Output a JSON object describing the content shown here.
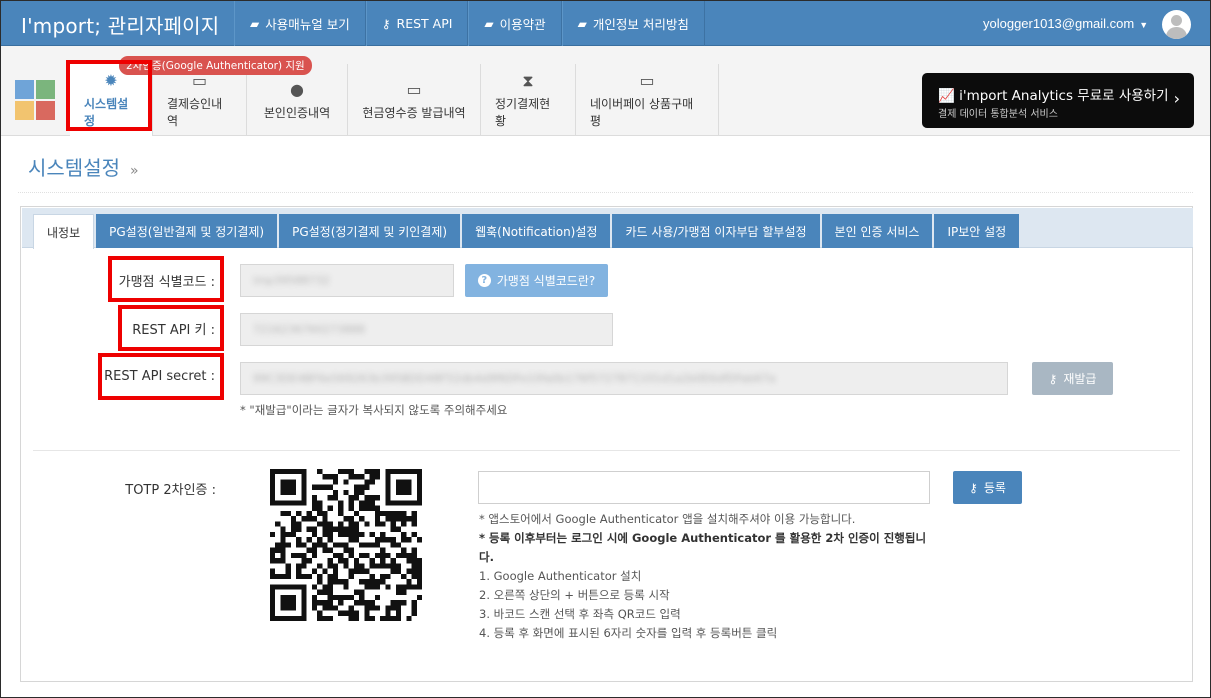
{
  "navbar": {
    "brand": "I'mport; 관리자페이지",
    "links": [
      {
        "icon": "book-icon",
        "glyph": "▰",
        "label": "사용매뉴얼 보기"
      },
      {
        "icon": "key-icon",
        "glyph": "⚷",
        "label": "REST API"
      },
      {
        "icon": "book-icon",
        "glyph": "▰",
        "label": "이용약관"
      },
      {
        "icon": "book-icon",
        "glyph": "▰",
        "label": "개인정보 처리방침"
      }
    ],
    "user_email": "yologger1013@gmail.com"
  },
  "subbar": {
    "badge": "2차인증(Google Authenticator) 지원",
    "tabs": [
      {
        "icon": "gear-icon",
        "glyph": "✹",
        "label": "시스템설정"
      },
      {
        "icon": "card-icon",
        "glyph": "▭",
        "label": "결제승인내역"
      },
      {
        "icon": "person-icon",
        "glyph": "●",
        "label": "본인인증내역"
      },
      {
        "icon": "card-icon",
        "glyph": "▭",
        "label": "현금영수증 발급내역"
      },
      {
        "icon": "hourglass-icon",
        "glyph": "⧗",
        "label": "정기결제현황"
      },
      {
        "icon": "card-icon",
        "glyph": "▭",
        "label": "네이버페이 상품구매평"
      }
    ],
    "analytics": {
      "title": "i'mport Analytics 무료로 사용하기",
      "subtitle": "결제 데이터 통합분석 서비스"
    },
    "logo_colors": [
      "#6fa4d8",
      "#7bb57d",
      "#f2c46f",
      "#d9695f"
    ]
  },
  "page": {
    "title": "시스템설정",
    "title_suffix": "»"
  },
  "settings_tabs": [
    "내정보",
    "PG설정(일반결제 및 정기결제)",
    "PG설정(정기결제 및 키인결제)",
    "웹훅(Notification)설정",
    "카드 사용/가맹점 이자부담 할부설정",
    "본인 인증 서비스",
    "IP보안 설정"
  ],
  "form": {
    "merchant_code_label": "가맹점 식별코드 :",
    "merchant_code_value": "imp39588732",
    "merchant_help_button": "가맹점 식별코드란?",
    "api_key_label": "REST API 키 :",
    "api_key_value": "7216236760273888",
    "api_secret_label": "REST API secret :",
    "api_secret_value": "99C3DE4BF6e569263b395BDD48F52db4d9f6DFe10fa0b176f5727871101d1a2b0E6dfDFab67a",
    "reissue_button": "재발급",
    "reissue_note": "* \"재발급\"이라는 글자가 복사되지 않도록 주의해주세요",
    "totp_label": "TOTP 2차인증 :",
    "register_button": "등록",
    "notes": [
      "* 앱스토어에서 Google Authenticator 앱을 설치해주셔야 이용 가능합니다.",
      "* 등록 이후부터는 로그인 시에 Google Authenticator 를 활용한 2차 인증이 진행됩니다.",
      "1. Google Authenticator 설치",
      "2. 오른쪽 상단의 + 버튼으로 등록 시작",
      "3. 바코드 스캔 선택 후 좌측 QR코드 입력",
      "4. 등록 후 화면에 표시된 6자리 숫자를 입력 후 등록버튼 클릭"
    ]
  }
}
